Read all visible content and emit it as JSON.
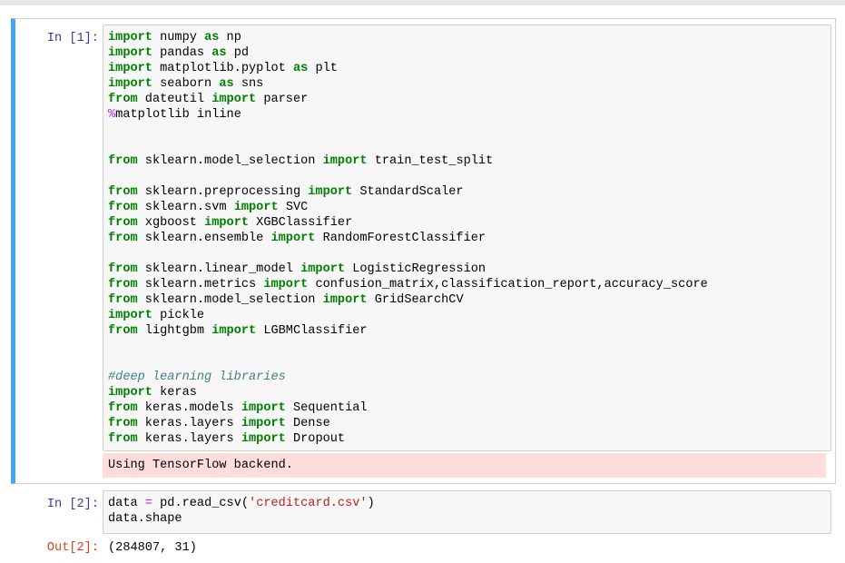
{
  "cells": [
    {
      "prompt": "In [1]:",
      "code_lines": [
        [
          {
            "t": "kw",
            "v": "import"
          },
          {
            "t": "n",
            "v": " numpy "
          },
          {
            "t": "kw",
            "v": "as"
          },
          {
            "t": "n",
            "v": " np"
          }
        ],
        [
          {
            "t": "kw",
            "v": "import"
          },
          {
            "t": "n",
            "v": " pandas "
          },
          {
            "t": "kw",
            "v": "as"
          },
          {
            "t": "n",
            "v": " pd"
          }
        ],
        [
          {
            "t": "kw",
            "v": "import"
          },
          {
            "t": "n",
            "v": " matplotlib.pyplot "
          },
          {
            "t": "kw",
            "v": "as"
          },
          {
            "t": "n",
            "v": " plt"
          }
        ],
        [
          {
            "t": "kw",
            "v": "import"
          },
          {
            "t": "n",
            "v": " seaborn "
          },
          {
            "t": "kw",
            "v": "as"
          },
          {
            "t": "n",
            "v": " sns"
          }
        ],
        [
          {
            "t": "kw",
            "v": "from"
          },
          {
            "t": "n",
            "v": " dateutil "
          },
          {
            "t": "kw",
            "v": "import"
          },
          {
            "t": "n",
            "v": " parser"
          }
        ],
        [
          {
            "t": "op",
            "v": "%"
          },
          {
            "t": "n",
            "v": "matplotlib inline"
          }
        ],
        [],
        [],
        [
          {
            "t": "kw",
            "v": "from"
          },
          {
            "t": "n",
            "v": " sklearn.model_selection "
          },
          {
            "t": "kw",
            "v": "import"
          },
          {
            "t": "n",
            "v": " train_test_split"
          }
        ],
        [],
        [
          {
            "t": "kw",
            "v": "from"
          },
          {
            "t": "n",
            "v": " sklearn.preprocessing "
          },
          {
            "t": "kw",
            "v": "import"
          },
          {
            "t": "n",
            "v": " StandardScaler"
          }
        ],
        [
          {
            "t": "kw",
            "v": "from"
          },
          {
            "t": "n",
            "v": " sklearn.svm "
          },
          {
            "t": "kw",
            "v": "import"
          },
          {
            "t": "n",
            "v": " SVC"
          }
        ],
        [
          {
            "t": "kw",
            "v": "from"
          },
          {
            "t": "n",
            "v": " xgboost "
          },
          {
            "t": "kw",
            "v": "import"
          },
          {
            "t": "n",
            "v": " XGBClassifier"
          }
        ],
        [
          {
            "t": "kw",
            "v": "from"
          },
          {
            "t": "n",
            "v": " sklearn.ensemble "
          },
          {
            "t": "kw",
            "v": "import"
          },
          {
            "t": "n",
            "v": " RandomForestClassifier"
          }
        ],
        [],
        [
          {
            "t": "kw",
            "v": "from"
          },
          {
            "t": "n",
            "v": " sklearn.linear_model "
          },
          {
            "t": "kw",
            "v": "import"
          },
          {
            "t": "n",
            "v": " LogisticRegression"
          }
        ],
        [
          {
            "t": "kw",
            "v": "from"
          },
          {
            "t": "n",
            "v": " sklearn.metrics "
          },
          {
            "t": "kw",
            "v": "import"
          },
          {
            "t": "n",
            "v": " confusion_matrix,classification_report,accuracy_score"
          }
        ],
        [
          {
            "t": "kw",
            "v": "from"
          },
          {
            "t": "n",
            "v": " sklearn.model_selection "
          },
          {
            "t": "kw",
            "v": "import"
          },
          {
            "t": "n",
            "v": " GridSearchCV"
          }
        ],
        [
          {
            "t": "kw",
            "v": "import"
          },
          {
            "t": "n",
            "v": " pickle"
          }
        ],
        [
          {
            "t": "kw",
            "v": "from"
          },
          {
            "t": "n",
            "v": " lightgbm "
          },
          {
            "t": "kw",
            "v": "import"
          },
          {
            "t": "n",
            "v": " LGBMClassifier"
          }
        ],
        [],
        [],
        [
          {
            "t": "cm",
            "v": "#deep learning libraries"
          }
        ],
        [
          {
            "t": "kw",
            "v": "import"
          },
          {
            "t": "n",
            "v": " keras"
          }
        ],
        [
          {
            "t": "kw",
            "v": "from"
          },
          {
            "t": "n",
            "v": " keras.models "
          },
          {
            "t": "kw",
            "v": "import"
          },
          {
            "t": "n",
            "v": " Sequential"
          }
        ],
        [
          {
            "t": "kw",
            "v": "from"
          },
          {
            "t": "n",
            "v": " keras.layers "
          },
          {
            "t": "kw",
            "v": "import"
          },
          {
            "t": "n",
            "v": " Dense"
          }
        ],
        [
          {
            "t": "kw",
            "v": "from"
          },
          {
            "t": "n",
            "v": " keras.layers "
          },
          {
            "t": "kw",
            "v": "import"
          },
          {
            "t": "n",
            "v": " Dropout"
          }
        ]
      ],
      "stderr": "Using TensorFlow backend."
    },
    {
      "prompt": "In [2]:",
      "code_lines": [
        [
          {
            "t": "n",
            "v": "data "
          },
          {
            "t": "op",
            "v": "="
          },
          {
            "t": "n",
            "v": " pd.read_csv("
          },
          {
            "t": "st",
            "v": "'creditcard.csv'"
          },
          {
            "t": "n",
            "v": ")"
          }
        ],
        [
          {
            "t": "n",
            "v": "data.shape"
          }
        ]
      ],
      "out_prompt": "Out[2]:",
      "output": "(284807, 31)"
    }
  ]
}
